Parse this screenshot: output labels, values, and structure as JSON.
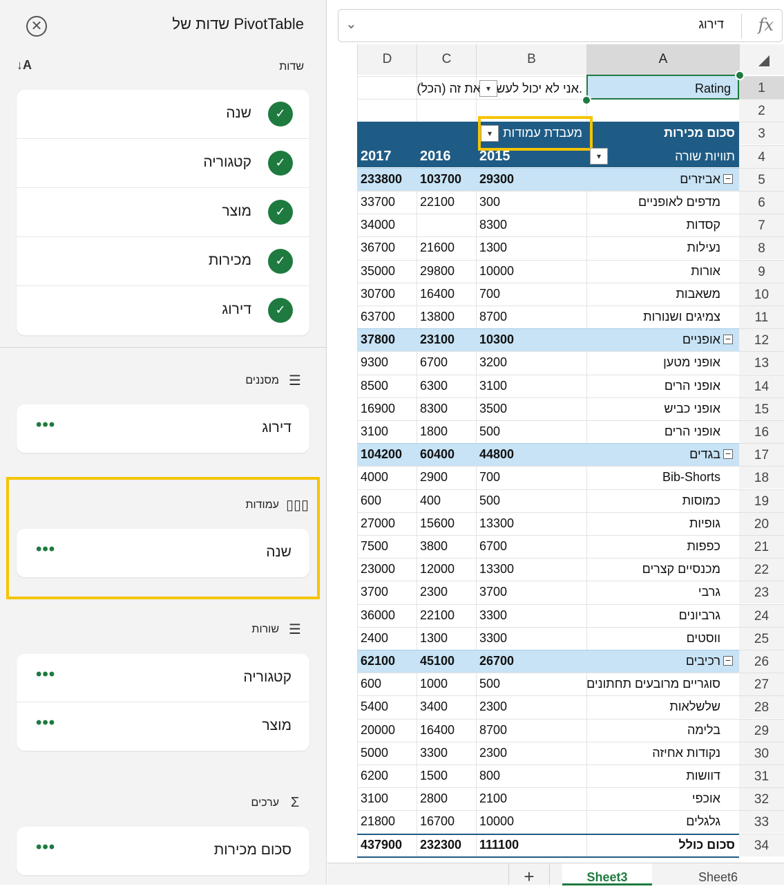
{
  "panel": {
    "title": "שדות של PivotTable",
    "fields_heading": "שדות",
    "fields": [
      {
        "label": "שנה",
        "checked": true
      },
      {
        "label": "קטגוריה",
        "checked": true
      },
      {
        "label": "מוצר",
        "checked": true
      },
      {
        "label": "מכירות",
        "checked": true
      },
      {
        "label": "דירוג",
        "checked": true
      }
    ],
    "filters_heading": "מסננים",
    "filters": [
      {
        "label": "דירוג"
      }
    ],
    "columns_heading": "עמודות",
    "columns": [
      {
        "label": "שנה"
      }
    ],
    "rows_heading": "שורות",
    "rows": [
      {
        "label": "קטגוריה"
      },
      {
        "label": "מוצר"
      }
    ],
    "values_heading": "ערכים",
    "values": [
      {
        "label": "סכום מכירות"
      }
    ],
    "more_label": "•••",
    "check_glyph": "✓"
  },
  "formula_bar": {
    "fx": "fx",
    "value": "דירוג"
  },
  "columns": [
    "A",
    "B",
    "C",
    "D"
  ],
  "row_numbers": [
    "1",
    "2",
    "3",
    "4",
    "5",
    "6",
    "7",
    "8",
    "9",
    "10",
    "11",
    "12",
    "13",
    "14",
    "15",
    "16",
    "17",
    "18",
    "19",
    "20",
    "21",
    "22",
    "23",
    "24",
    "25",
    "26",
    "27",
    "28",
    "29",
    "30",
    "31",
    "32",
    "33",
    "34"
  ],
  "pivot": {
    "filter_label": "Rating",
    "filter_value": "(הכל) אני לא יכול לעשות את זה.",
    "values_label": "סכום מכירות",
    "column_labels": "מעבדת עמודות",
    "row_labels": "תוויות שורה",
    "years": [
      "2015",
      "2016",
      "2017"
    ],
    "rows": [
      {
        "label": "אביזרים",
        "category": true,
        "v": [
          "29300",
          "103700",
          "233800"
        ]
      },
      {
        "label": "מדפים לאופניים",
        "v": [
          "300",
          "22100",
          "33700"
        ]
      },
      {
        "label": "קסדות",
        "v": [
          "8300",
          "",
          "34000"
        ]
      },
      {
        "label": "נעילות",
        "v": [
          "1300",
          "21600",
          "36700"
        ]
      },
      {
        "label": "אורות",
        "v": [
          "10000",
          "29800",
          "35000"
        ]
      },
      {
        "label": "משאבות",
        "v": [
          "700",
          "16400",
          "30700"
        ]
      },
      {
        "label": "צמיגים ושנורות",
        "v": [
          "8700",
          "13800",
          "63700"
        ]
      },
      {
        "label": "אופניים",
        "category": true,
        "v": [
          "10300",
          "23100",
          "37800"
        ]
      },
      {
        "label": "אופני מטען",
        "v": [
          "3200",
          "6700",
          "9300"
        ]
      },
      {
        "label": "אופני הרים",
        "v": [
          "3100",
          "6300",
          "8500"
        ]
      },
      {
        "label": "אופני כביש",
        "v": [
          "3500",
          "8300",
          "16900"
        ]
      },
      {
        "label": "אופני הרים",
        "v": [
          "500",
          "1800",
          "3100"
        ]
      },
      {
        "label": "בגדים",
        "category": true,
        "v": [
          "44800",
          "60400",
          "104200"
        ]
      },
      {
        "label": "Bib-Shorts",
        "v": [
          "700",
          "2900",
          "4000"
        ]
      },
      {
        "label": "כמוסות",
        "v": [
          "500",
          "400",
          "600"
        ]
      },
      {
        "label": "גופיות",
        "v": [
          "13300",
          "15600",
          "27000"
        ]
      },
      {
        "label": "כפפות",
        "v": [
          "6700",
          "3800",
          "7500"
        ]
      },
      {
        "label": "מכנסיים קצרים",
        "v": [
          "13300",
          "12000",
          "23000"
        ]
      },
      {
        "label": "גרבי",
        "v": [
          "3700",
          "2300",
          "3700"
        ]
      },
      {
        "label": "גרביונים",
        "v": [
          "3300",
          "22100",
          "36000"
        ]
      },
      {
        "label": "ווסטים",
        "v": [
          "3300",
          "1300",
          "2400"
        ]
      },
      {
        "label": "רכיבים",
        "category": true,
        "v": [
          "26700",
          "45100",
          "62100"
        ]
      },
      {
        "label": "סוגריים מרובעים תחתונים",
        "v": [
          "500",
          "1000",
          "600"
        ]
      },
      {
        "label": "שלשלאות",
        "v": [
          "2300",
          "3400",
          "5400"
        ]
      },
      {
        "label": "בלימה",
        "v": [
          "8700",
          "16400",
          "20000"
        ]
      },
      {
        "label": "נקודות אחיזה",
        "v": [
          "2300",
          "3300",
          "5000"
        ]
      },
      {
        "label": "דוושות",
        "v": [
          "800",
          "1500",
          "6200"
        ]
      },
      {
        "label": "אוכפי",
        "v": [
          "2100",
          "2800",
          "3100"
        ]
      },
      {
        "label": "גלגלים",
        "v": [
          "10000",
          "16700",
          "21800"
        ]
      },
      {
        "label": "סכום כולל",
        "total": true,
        "v": [
          "111100",
          "232300",
          "437900"
        ]
      }
    ]
  },
  "tabs": [
    "Sheet6",
    "Sheet3"
  ],
  "tab_add": "+",
  "active_tab": "Sheet3"
}
